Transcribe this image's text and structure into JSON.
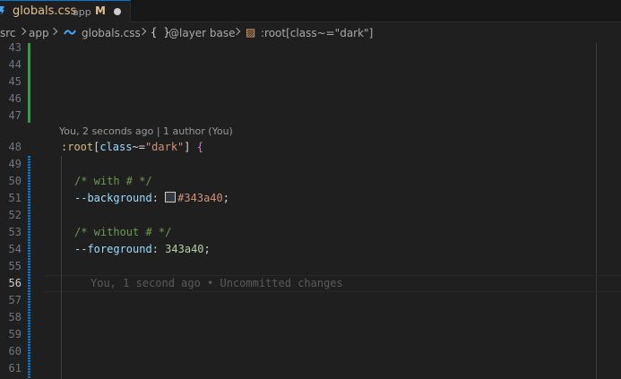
{
  "tab": {
    "filename": "globals.css",
    "folder": "app",
    "status": "M"
  },
  "breadcrumb": {
    "src": "src",
    "app": "app",
    "file": "globals.css",
    "layer_icon": "{ }",
    "layer": "@layer base",
    "selector": ":root[class~=\"dark\"]"
  },
  "editor": {
    "line_numbers": [
      "43",
      "44",
      "45",
      "46",
      "47",
      "48",
      "49",
      "50",
      "51",
      "52",
      "53",
      "54",
      "55",
      "56",
      "57",
      "58",
      "59",
      "60",
      "61"
    ],
    "active_line": "56",
    "codelens": "You, 2 seconds ago | 1 author (You)",
    "code": {
      "l48_selector": ":root",
      "l48_open": "[",
      "l48_attr": "class",
      "l48_op": "~=",
      "l48_str": "\"dark\"",
      "l48_close": "]",
      "l48_brace": "{",
      "l50_comment": "/* with # */",
      "l51_prop": "--background",
      "l51_colon": ":",
      "l51_value": "#343a40",
      "l51_semi": ";",
      "l53_comment": "/* without # */",
      "l54_prop": "--foreground",
      "l54_colon": ":",
      "l54_value": "343a40",
      "l54_semi": ";"
    },
    "blame": "You, 1 second ago • Uncommitted changes"
  },
  "colors": {
    "accent": "#0078d4",
    "modified_file": "#e2c08d",
    "diff_added": "#2ea043",
    "swatch": "#343a40"
  },
  "icons": {
    "tab": "css-file-icon",
    "breadcrumb_file": "css-file-icon",
    "breadcrumb_layer": "braces-icon",
    "breadcrumb_selector": "selector-icon"
  }
}
